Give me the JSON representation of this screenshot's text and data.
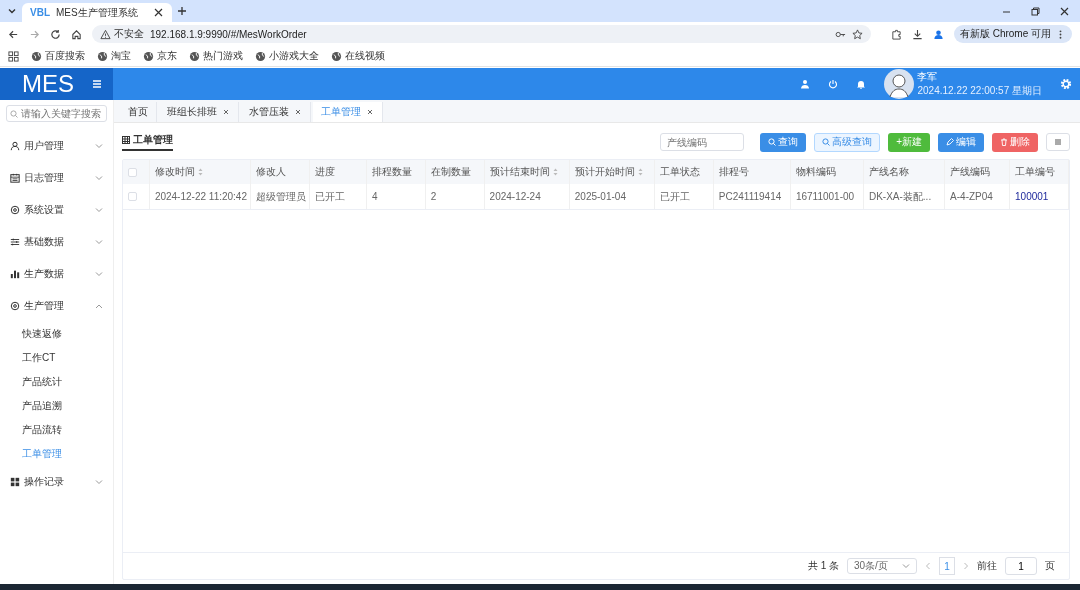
{
  "browser": {
    "tab_title": "MES生产管理系统",
    "tab_icon": "VBL",
    "security": "不安全",
    "url": "192.168.1.9:9990/#/MesWorkOrder",
    "update_button": "有新版 Chrome 可用",
    "bookmarks": [
      "百度搜索",
      "淘宝",
      "京东",
      "热门游戏",
      "小游戏大全",
      "在线视频"
    ]
  },
  "header": {
    "logo": "MES",
    "user_name": "李军",
    "datetime": "2024.12.22 22:00:57 星期日"
  },
  "sidebar": {
    "search_placeholder": "请输入关键字搜索",
    "items": [
      {
        "label": "用户管理",
        "expanded": false
      },
      {
        "label": "日志管理",
        "expanded": false
      },
      {
        "label": "系统设置",
        "expanded": false
      },
      {
        "label": "基础数据",
        "expanded": false
      },
      {
        "label": "生产数据",
        "expanded": false
      },
      {
        "label": "生产管理",
        "expanded": true,
        "children": [
          {
            "label": "快速返修",
            "selected": false
          },
          {
            "label": "工作CT",
            "selected": false
          },
          {
            "label": "产品统计",
            "selected": false
          },
          {
            "label": "产品追溯",
            "selected": false
          },
          {
            "label": "产品流转",
            "selected": false
          },
          {
            "label": "工单管理",
            "selected": true
          }
        ]
      },
      {
        "label": "操作记录",
        "expanded": false
      }
    ]
  },
  "page_tabs": [
    {
      "label": "首页",
      "closable": false,
      "selected": false
    },
    {
      "label": "班组长排班",
      "closable": true,
      "selected": false
    },
    {
      "label": "水管压装",
      "closable": true,
      "selected": false
    },
    {
      "label": "工单管理",
      "closable": true,
      "selected": true
    }
  ],
  "page_title": "工单管理",
  "filter": {
    "placeholder": "产线编码"
  },
  "buttons": [
    {
      "label": "查询",
      "kind": "primary"
    },
    {
      "label": "高级查询",
      "kind": "plain"
    },
    {
      "label": "+新建",
      "kind": "success"
    },
    {
      "label": "编辑",
      "kind": "edit"
    },
    {
      "label": "删除",
      "kind": "danger"
    }
  ],
  "table": {
    "all_checked": false,
    "columns": [
      {
        "label": "修改时间",
        "sortable": true,
        "kind": "text"
      },
      {
        "label": "修改人",
        "sortable": false,
        "kind": "text"
      },
      {
        "label": "进度",
        "sortable": false,
        "kind": "text"
      },
      {
        "label": "排程数量",
        "sortable": false,
        "kind": "text"
      },
      {
        "label": "在制数量",
        "sortable": false,
        "kind": "text"
      },
      {
        "label": "预计结束时间",
        "sortable": true,
        "kind": "text"
      },
      {
        "label": "预计开始时间",
        "sortable": true,
        "kind": "text"
      },
      {
        "label": "工单状态",
        "sortable": false,
        "kind": "text"
      },
      {
        "label": "排程号",
        "sortable": false,
        "kind": "text"
      },
      {
        "label": "物料编码",
        "sortable": false,
        "kind": "text"
      },
      {
        "label": "产线名称",
        "sortable": false,
        "kind": "text"
      },
      {
        "label": "产线编码",
        "sortable": false,
        "kind": "text"
      },
      {
        "label": "工单编号",
        "sortable": false,
        "kind": "link"
      }
    ],
    "rows": [
      {
        "checked": false,
        "cells": [
          "2024-12-22 11:20:42",
          "超级管理员",
          "已开工",
          "4",
          "2",
          "2024-12-24",
          "2025-01-04",
          "已开工",
          "PC241119414",
          "16711001-00",
          "DK-XA-装配...",
          "A-4-ZP04",
          "100001"
        ]
      }
    ]
  },
  "pagination": {
    "total": "共 1 条",
    "page_size": "30条/页",
    "pages": [
      {
        "label": "1",
        "selected": true
      }
    ],
    "goto_label": "前往",
    "goto_value": "1",
    "goto_suffix": "页"
  }
}
